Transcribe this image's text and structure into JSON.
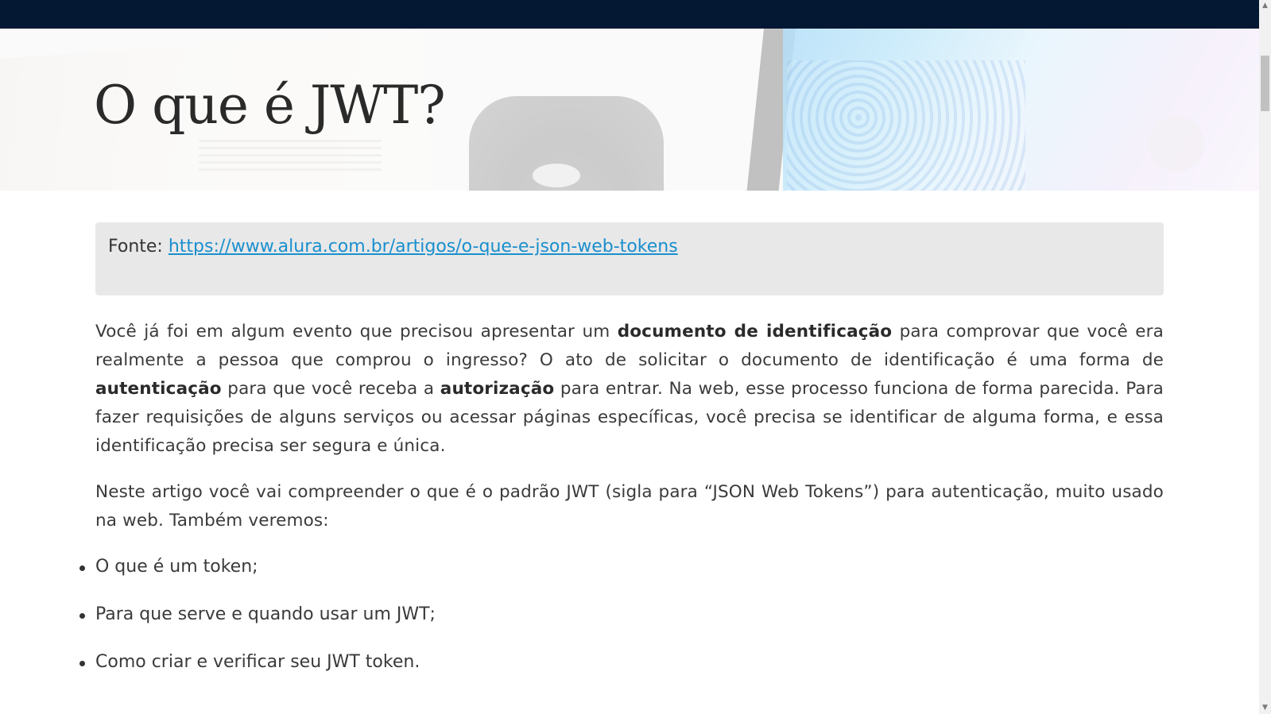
{
  "article": {
    "title": "O que é JWT?",
    "source_prefix": "Fonte: ",
    "source_link": "https://www.alura.com.br/artigos/o-que-e-json-web-tokens",
    "p1": {
      "t1": "Você já foi em algum evento que precisou apresentar um ",
      "b1": "documento de identificação",
      "t2": " para comprovar que você era realmente a pessoa que comprou o ingresso? O ato de solicitar o documento de identificação é uma forma de ",
      "b2": "autenticação",
      "t3": " para que você receba a ",
      "b3": "autorização",
      "t4": " para entrar. Na web, esse processo funciona de forma parecida. Para fazer requisições de alguns serviços ou acessar páginas específicas, você precisa se identificar de alguma forma, e essa identificação precisa ser segura e única."
    },
    "p2": "Neste artigo você vai compreender o que é o padrão JWT (sigla para “JSON Web Tokens”) para autenticação, muito usado na web. Também veremos:",
    "bullets": [
      "O que é um token;",
      "Para que serve e quando usar um JWT;",
      "Como criar e verificar seu JWT token."
    ]
  },
  "icons": {
    "scroll_up": "▲",
    "scroll_down": "▼"
  },
  "colors": {
    "top_bar": "#041733",
    "link": "#1a8fce",
    "source_box_bg": "#e8e8e8"
  }
}
